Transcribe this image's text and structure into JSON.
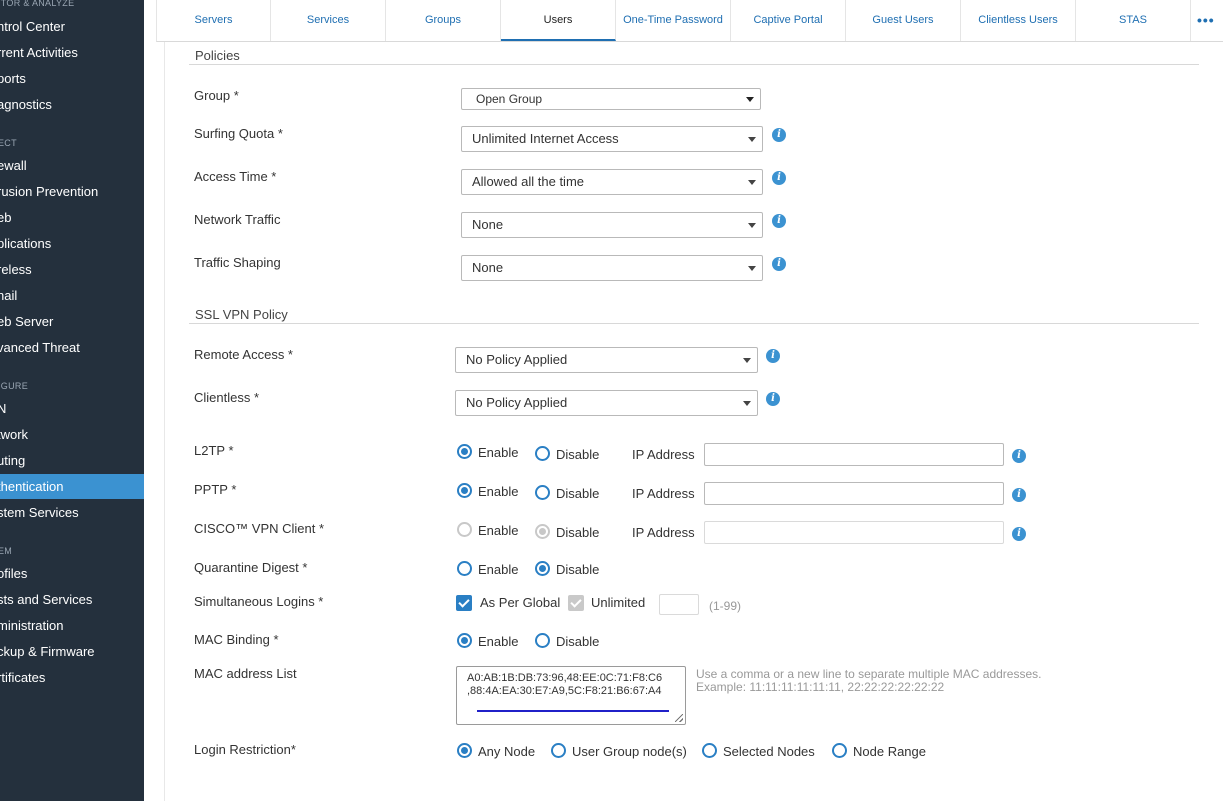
{
  "sidebar": {
    "sections": {
      "monitor": "ITOR & ANALYZE",
      "protect": "ECT",
      "configure": "IGURE",
      "system": "EM"
    },
    "items": [
      {
        "label": "ntrol Center"
      },
      {
        "label": "rrent Activities"
      },
      {
        "label": "ports"
      },
      {
        "label": "agnostics"
      },
      {
        "label": "ewall"
      },
      {
        "label": "rusion Prevention"
      },
      {
        "label": "eb"
      },
      {
        "label": "plications"
      },
      {
        "label": "reless"
      },
      {
        "label": "nail"
      },
      {
        "label": "eb Server"
      },
      {
        "label": "vanced Threat"
      },
      {
        "label": "N"
      },
      {
        "label": "twork"
      },
      {
        "label": "uting"
      },
      {
        "label": "thentication"
      },
      {
        "label": "stem Services"
      },
      {
        "label": "ofiles"
      },
      {
        "label": "sts and Services"
      },
      {
        "label": "ministration"
      },
      {
        "label": "ckup & Firmware"
      },
      {
        "label": "rtificates"
      }
    ]
  },
  "tabs": [
    {
      "label": "Servers"
    },
    {
      "label": "Services"
    },
    {
      "label": "Groups"
    },
    {
      "label": "Users"
    },
    {
      "label": "One-Time Password"
    },
    {
      "label": "Captive Portal"
    },
    {
      "label": "Guest Users"
    },
    {
      "label": "Clientless Users"
    },
    {
      "label": "STAS"
    }
  ],
  "tabs_more": "•••",
  "policies": {
    "title": "Policies",
    "group": {
      "label": "Group *",
      "value": "Open Group"
    },
    "surfing_quota": {
      "label": "Surfing Quota *",
      "value": "Unlimited Internet Access"
    },
    "access_time": {
      "label": "Access Time *",
      "value": "Allowed all the time"
    },
    "network_traffic": {
      "label": "Network Traffic",
      "value": "None"
    },
    "traffic_shaping": {
      "label": "Traffic Shaping",
      "value": "None"
    }
  },
  "ssl_vpn": {
    "title": "SSL VPN Policy",
    "remote_access": {
      "label": "Remote Access *",
      "value": "No Policy Applied"
    },
    "clientless": {
      "label": "Clientless *",
      "value": "No Policy Applied"
    }
  },
  "options": {
    "enable": "Enable",
    "disable": "Disable",
    "ip_address": "IP Address"
  },
  "l2tp": {
    "label": "L2TP *",
    "selected": "Enable"
  },
  "pptp": {
    "label": "PPTP *",
    "selected": "Enable"
  },
  "cisco": {
    "label": "CISCO™ VPN Client *",
    "selected": "Disable",
    "disabled": true
  },
  "quarantine": {
    "label": "Quarantine Digest *",
    "selected": "Disable"
  },
  "simultaneous": {
    "label": "Simultaneous Logins *",
    "as_per_global": "As Per Global",
    "unlimited": "Unlimited",
    "range": "(1-99)"
  },
  "mac_binding": {
    "label": "MAC Binding *",
    "selected": "Enable"
  },
  "mac_list": {
    "label": "MAC address List",
    "line1": "A0:AB:1B:DB:73:96,48:EE:0C:71:F8:C6",
    "line2": ",88:4A:EA:30:E7:A9,5C:F8:21:B6:67:A4",
    "hint1": "Use a comma or a new line to separate multiple MAC addresses.",
    "hint2": "Example: 11:11:11:11:11:11, 22:22:22:22:22:22"
  },
  "login_restriction": {
    "label": "Login Restriction*",
    "options": [
      "Any Node",
      "User Group node(s)",
      "Selected Nodes",
      "Node Range"
    ],
    "selected": "Any Node"
  },
  "info_glyph": "i"
}
